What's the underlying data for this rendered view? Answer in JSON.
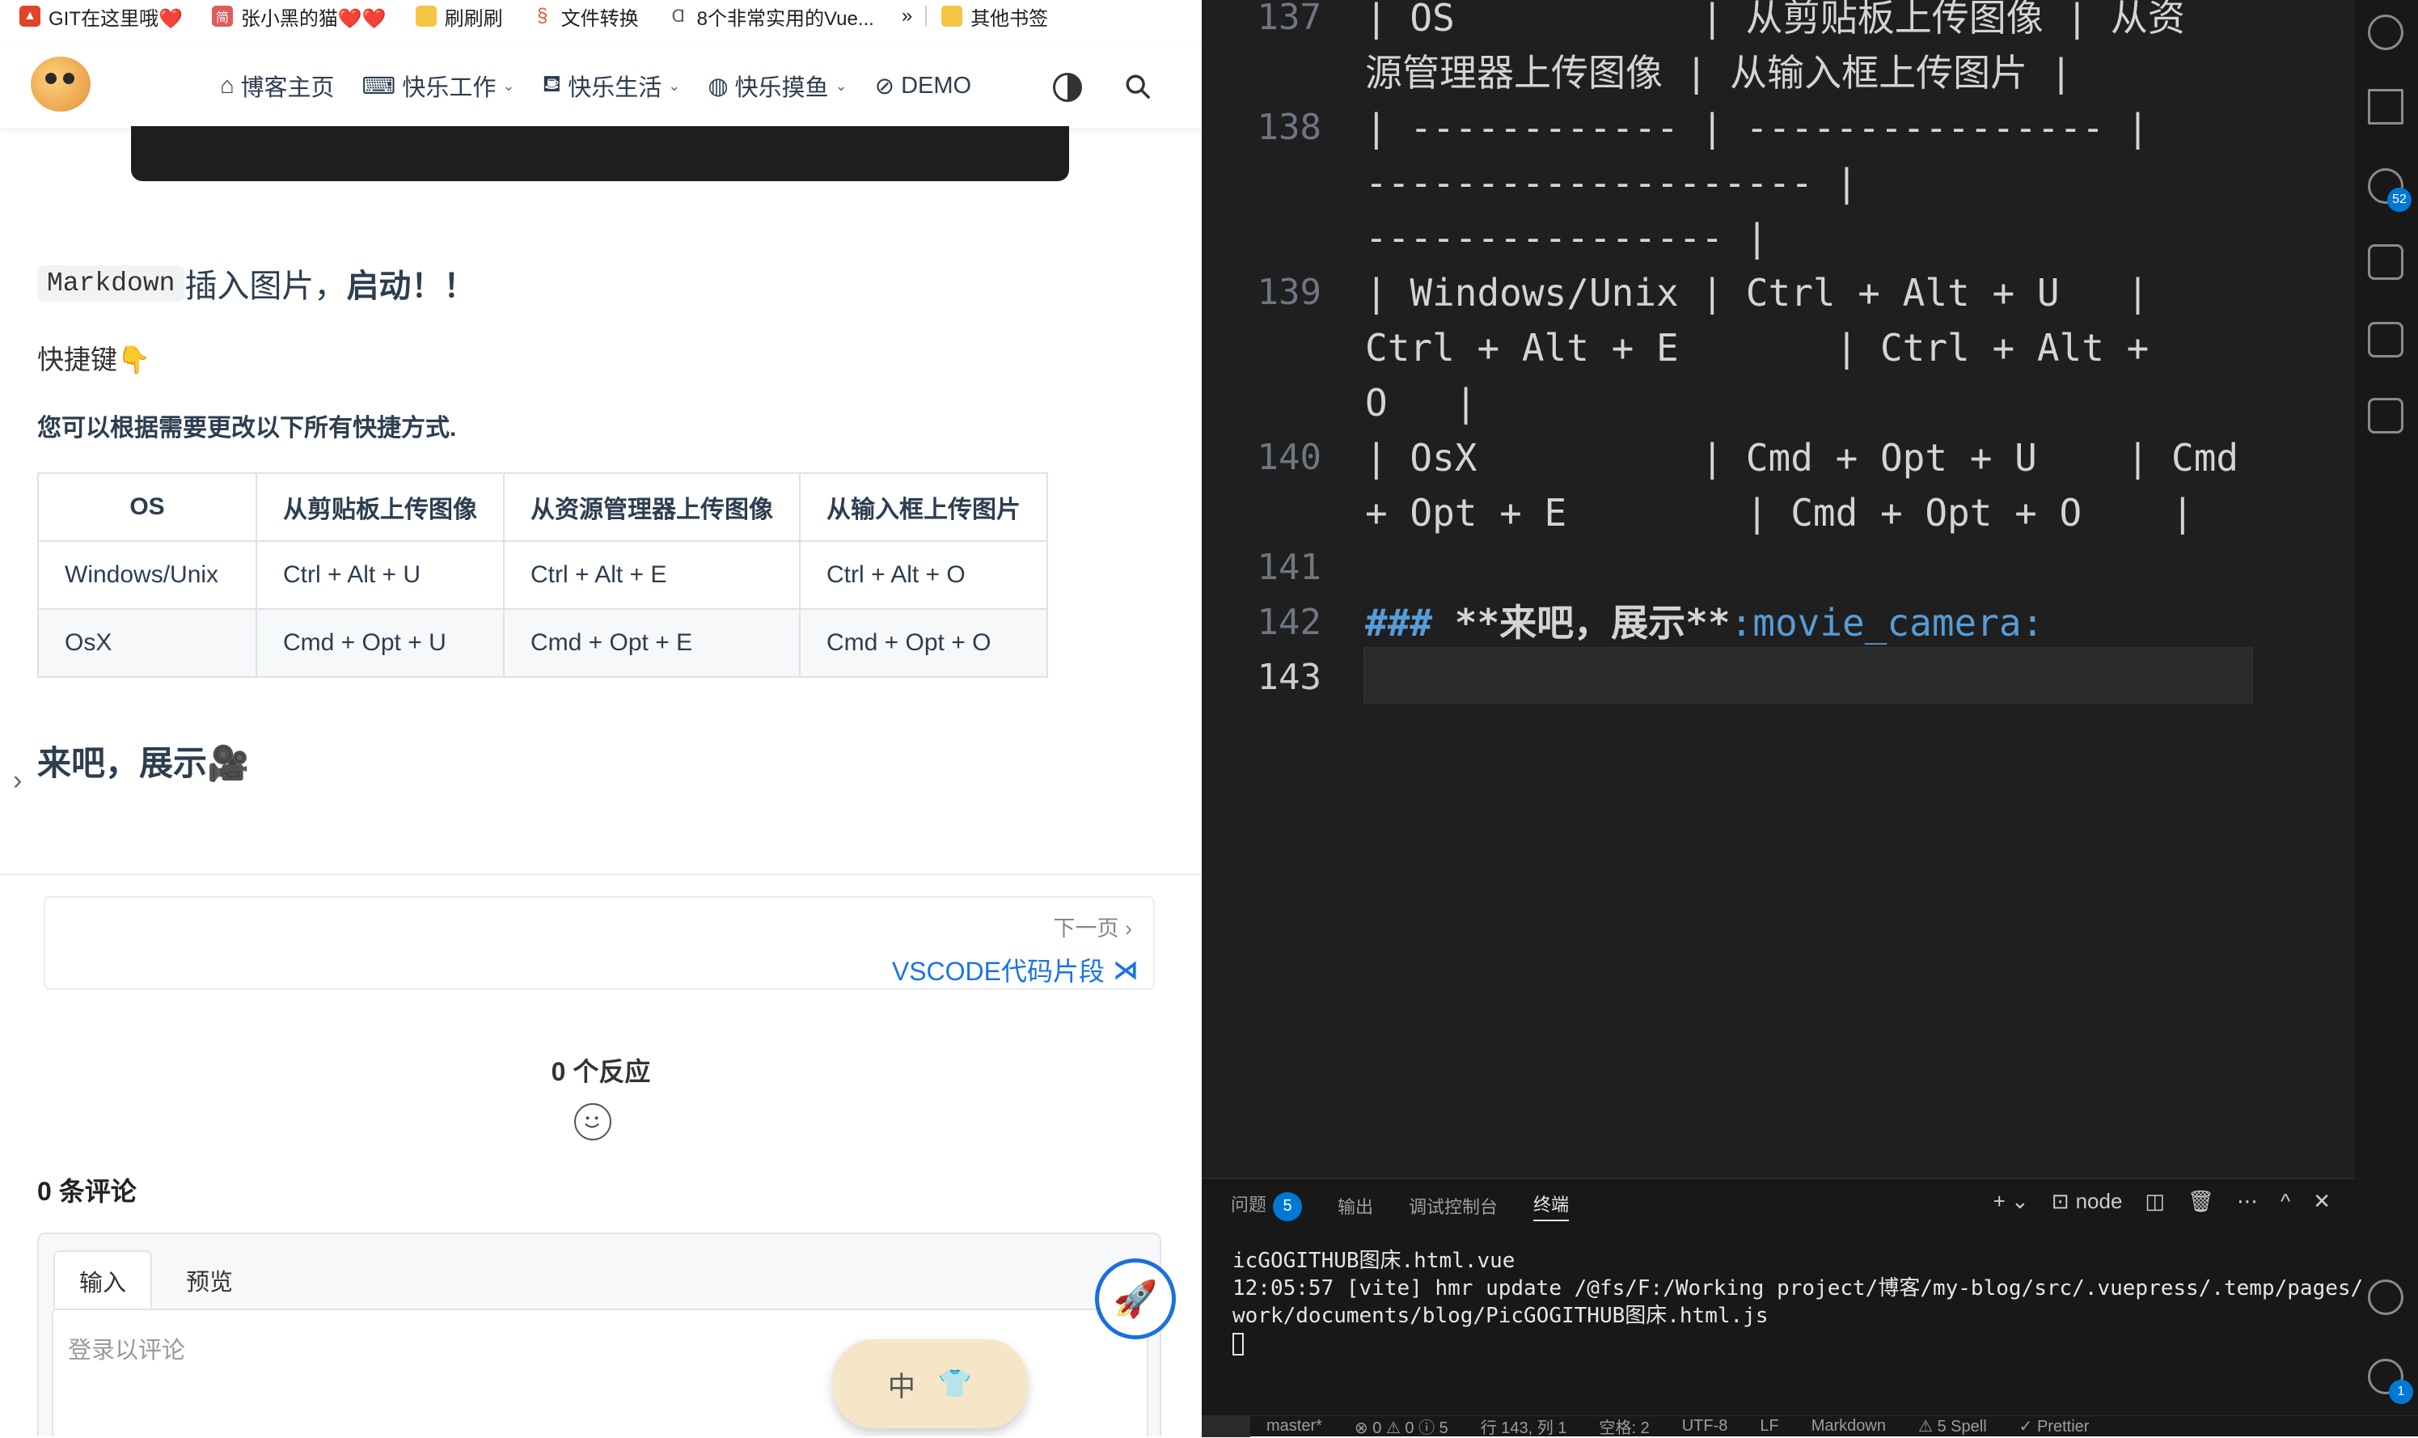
{
  "bookmarks": [
    {
      "icon": "gitlab-icon",
      "label": "GIT在这里哦❤️",
      "color": "#e24329"
    },
    {
      "icon": "jian-icon",
      "label": "张小黑的猫❤️❤️",
      "color": "#e05c5c"
    },
    {
      "icon": "folder-icon",
      "label": "刷刷刷",
      "color": "#f4c542"
    },
    {
      "icon": "convert-icon",
      "label": "文件转换",
      "color": "#e8553a"
    },
    {
      "icon": "vue-icon",
      "label": "8个非常实用的Vue...",
      "color": "#555555"
    }
  ],
  "bookmarks_overflow": "»",
  "other_bookmarks": "其他书签",
  "nav": {
    "items": [
      {
        "icon": "home-icon",
        "label": "博客主页"
      },
      {
        "icon": "keyboard-icon",
        "label": "快乐工作"
      },
      {
        "icon": "sofa-icon",
        "label": "快乐生活"
      },
      {
        "icon": "globe-icon",
        "label": "快乐摸鱼"
      },
      {
        "icon": "demo-icon",
        "label": "DEMO"
      }
    ]
  },
  "article": {
    "heading_code": "Markdown",
    "heading_rest": "插入图片，",
    "heading_bold": "启动！！",
    "shortcut_label": "快捷键👇",
    "note": "您可以根据需要更改以下所有快捷方式.",
    "table": {
      "headers": [
        "OS",
        "从剪贴板上传图像",
        "从资源管理器上传图像",
        "从输入框上传图片"
      ],
      "rows": [
        [
          "Windows/Unix",
          "Ctrl + Alt + U",
          "Ctrl + Alt + E",
          "Ctrl + Alt + O"
        ],
        [
          "OsX",
          "Cmd + Opt + U",
          "Cmd + Opt + E",
          "Cmd + Opt + O"
        ]
      ]
    },
    "h3": "来吧，展示🎥"
  },
  "pager": {
    "label": "下一页 ›",
    "link": "VSCODE代码片段"
  },
  "reactions": {
    "title": "0 个反应"
  },
  "comments": {
    "title": "0 条评论",
    "tab_input": "输入",
    "tab_preview": "预览",
    "placeholder": "登录以评论"
  },
  "ime": {
    "mode": "中"
  },
  "editor": {
    "lines": [
      {
        "num": "137",
        "text": "| OS           | 从剪贴板上传图像 | 从资"
      },
      {
        "num": "",
        "text": "源管理器上传图像 | 从输入框上传图片 |"
      },
      {
        "num": "138",
        "text": "| ------------ | ---------------- |"
      },
      {
        "num": "",
        "text": "-------------------- |"
      },
      {
        "num": "",
        "text": "---------------- |"
      },
      {
        "num": "139",
        "text": "| Windows/Unix | Ctrl + Alt + U   |"
      },
      {
        "num": "",
        "text": "Ctrl + Alt + E       | Ctrl + Alt +"
      },
      {
        "num": "",
        "text": "O   |"
      },
      {
        "num": "140",
        "text": "| OsX          | Cmd + Opt + U    | Cmd"
      },
      {
        "num": "",
        "text": "+ Opt + E        | Cmd + Opt + O    |"
      },
      {
        "num": "141",
        "text": ""
      },
      {
        "num": "142",
        "text": ""
      },
      {
        "num": "143",
        "text": ""
      }
    ],
    "line142": {
      "hash": "###",
      "bold": "**来吧，展示**",
      "emoji": ":movie_camera:"
    }
  },
  "activity_badges": {
    "source_control": "52",
    "settings": "1"
  },
  "panel": {
    "tabs": [
      "问题",
      "输出",
      "调试控制台",
      "终端"
    ],
    "problems_count": "5",
    "shell": "node",
    "terminal_lines": [
      "icGOGITHUB图床.html.vue",
      "12:05:57 [vite] hmr update /@fs/F:/Working project/博客/my-blog/src/.vuepress/.temp/pages/",
      "work/documents/blog/PicGOGITHUB图床.html.js"
    ]
  },
  "status": {
    "branch": "master*",
    "problems": "⊗ 0 ⚠ 0 ⓘ 5",
    "position": "行 143, 列 1",
    "spaces": "空格: 2",
    "encoding": "UTF-8",
    "eol": "LF",
    "language": "Markdown",
    "spell": "⚠ 5 Spell",
    "prettier": "✓ Prettier"
  }
}
